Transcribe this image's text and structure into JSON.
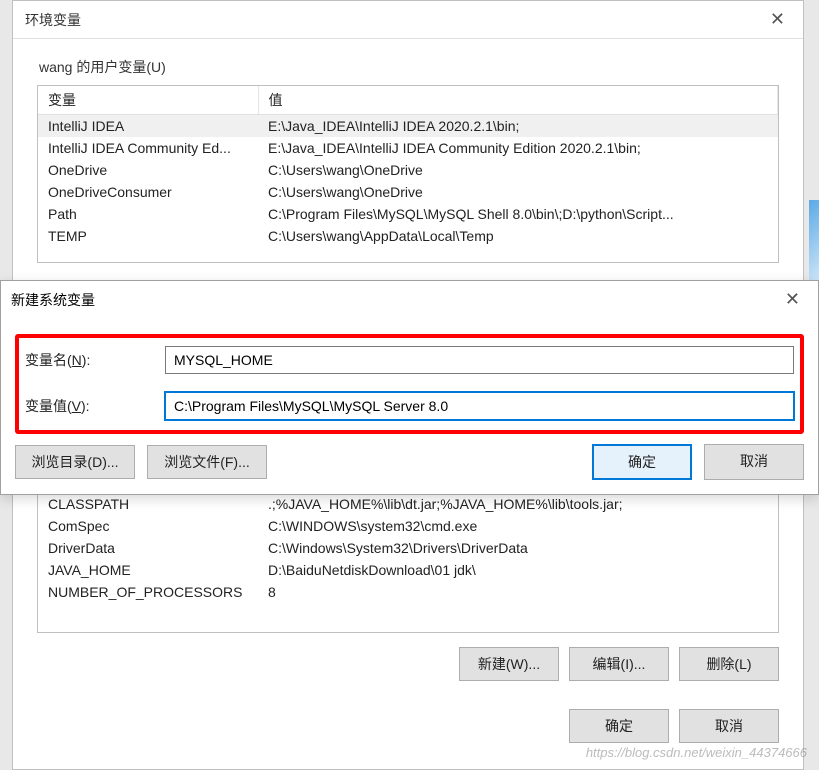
{
  "env_dialog": {
    "title": "环境变量",
    "user_vars_label": "wang 的用户变量(U)",
    "headers": {
      "var": "变量",
      "val": "值"
    },
    "user_rows": [
      {
        "var": "IntelliJ IDEA",
        "val": "E:\\Java_IDEA\\IntelliJ IDEA 2020.2.1\\bin;"
      },
      {
        "var": "IntelliJ IDEA Community Ed...",
        "val": "E:\\Java_IDEA\\IntelliJ IDEA Community Edition 2020.2.1\\bin;"
      },
      {
        "var": "OneDrive",
        "val": "C:\\Users\\wang\\OneDrive"
      },
      {
        "var": "OneDriveConsumer",
        "val": "C:\\Users\\wang\\OneDrive"
      },
      {
        "var": "Path",
        "val": "C:\\Program Files\\MySQL\\MySQL Shell 8.0\\bin\\;D:\\python\\Script..."
      },
      {
        "var": "TEMP",
        "val": "C:\\Users\\wang\\AppData\\Local\\Temp"
      }
    ],
    "system_rows": [
      {
        "var": "CLASSPATH",
        "val": ".;%JAVA_HOME%\\lib\\dt.jar;%JAVA_HOME%\\lib\\tools.jar;"
      },
      {
        "var": "ComSpec",
        "val": "C:\\WINDOWS\\system32\\cmd.exe"
      },
      {
        "var": "DriverData",
        "val": "C:\\Windows\\System32\\Drivers\\DriverData"
      },
      {
        "var": "JAVA_HOME",
        "val": "D:\\BaiduNetdiskDownload\\01 jdk\\"
      },
      {
        "var": "NUMBER_OF_PROCESSORS",
        "val": "8"
      }
    ],
    "buttons": {
      "new": "新建(W)...",
      "edit": "编辑(I)...",
      "delete": "删除(L)",
      "ok": "确定",
      "cancel": "取消"
    }
  },
  "new_dialog": {
    "title": "新建系统变量",
    "name_label": "变量名(N):",
    "value_label": "变量值(V):",
    "name_value": "MYSQL_HOME",
    "value_value": "C:\\Program Files\\MySQL\\MySQL Server 8.0",
    "browse_dir": "浏览目录(D)...",
    "browse_file": "浏览文件(F)...",
    "ok": "确定",
    "cancel": "取消"
  },
  "watermark": "https://blog.csdn.net/weixin_44374666"
}
